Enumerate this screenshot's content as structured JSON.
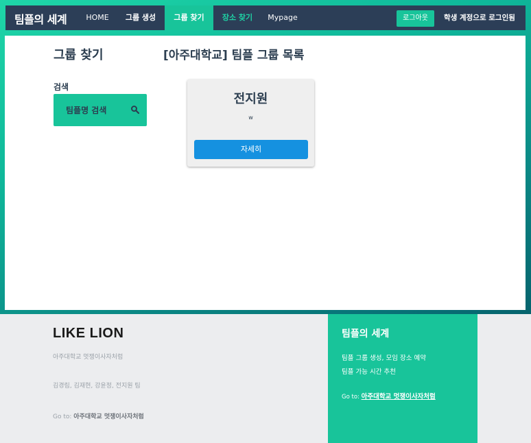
{
  "navbar": {
    "brand": "팀플의 세계",
    "items": [
      {
        "label": "HOME"
      },
      {
        "label": "그룹 생성"
      },
      {
        "label": "그룹 찾기"
      },
      {
        "label": "장소 찾기"
      },
      {
        "label": "Mypage"
      }
    ],
    "logout_label": "로그아웃",
    "login_status": "학생 계정으로 로그인됨"
  },
  "main": {
    "page_title": "그룹 찾기",
    "list_title": "[아주대학교] 팀플 그룹 목록",
    "search_label": "검색",
    "search_placeholder": "팀플명 검색",
    "groups": [
      {
        "name": "전지원",
        "desc": "w",
        "button_label": "자세히"
      }
    ]
  },
  "footer": {
    "logo": "LIKE LION",
    "org": "아주대학교 멋쟁이사자처럼",
    "team": "김경림, 김재현, 강윤정, 전지원 팀",
    "goto_prefix": "Go to:",
    "goto_link": "아주대학교 멋쟁이사자처럼",
    "right_title": "팀플의 세계",
    "right_line1": "팀플 그룹 생성, 모임 장소 예약",
    "right_line2": "팀플 가능 시간 추천",
    "right_goto_prefix": "Go to:",
    "right_goto_link": "아주대학교 멋쟁이사자처럼"
  },
  "colors": {
    "navbar": "#2c3e57",
    "accent": "#18c49a",
    "button_blue": "#1591e0",
    "title_text": "#2c3e50"
  }
}
